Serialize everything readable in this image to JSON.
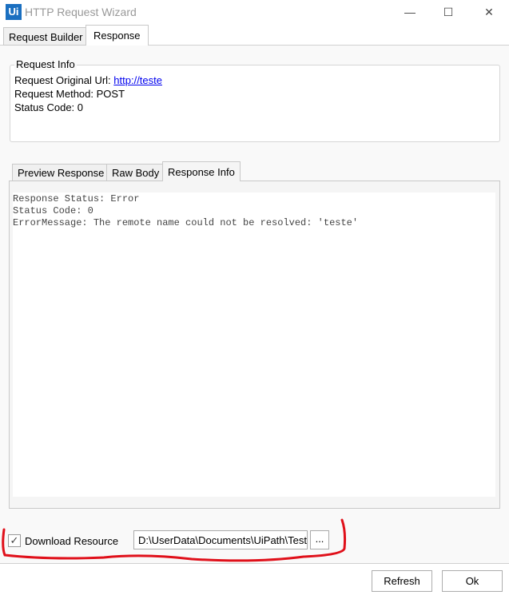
{
  "window": {
    "title": "HTTP Request Wizard",
    "logo": "Ui",
    "minimize": "—",
    "maximize": "☐",
    "close": "✕"
  },
  "tabs": [
    "Request Builder",
    "Response"
  ],
  "request_info": {
    "label": "Request Info",
    "url_label": "Request Original Url:",
    "url": "http://teste",
    "method": "Request Method: POST",
    "status": "Status Code: 0"
  },
  "response_tabs": [
    "Preview Response",
    "Raw Body",
    "Response Info"
  ],
  "response_text": [
    "Response Status: Error",
    "Status Code: 0",
    "ErrorMessage: The remote name could not be resolved: 'teste'"
  ],
  "download": {
    "label": "Download Resource",
    "checked": true,
    "check_glyph": "✓",
    "path": "D:\\UserData\\Documents\\UiPath\\Teste",
    "browse": "..."
  },
  "buttons": {
    "refresh": "Refresh",
    "ok": "Ok"
  },
  "annotation_color": "#e0101a"
}
